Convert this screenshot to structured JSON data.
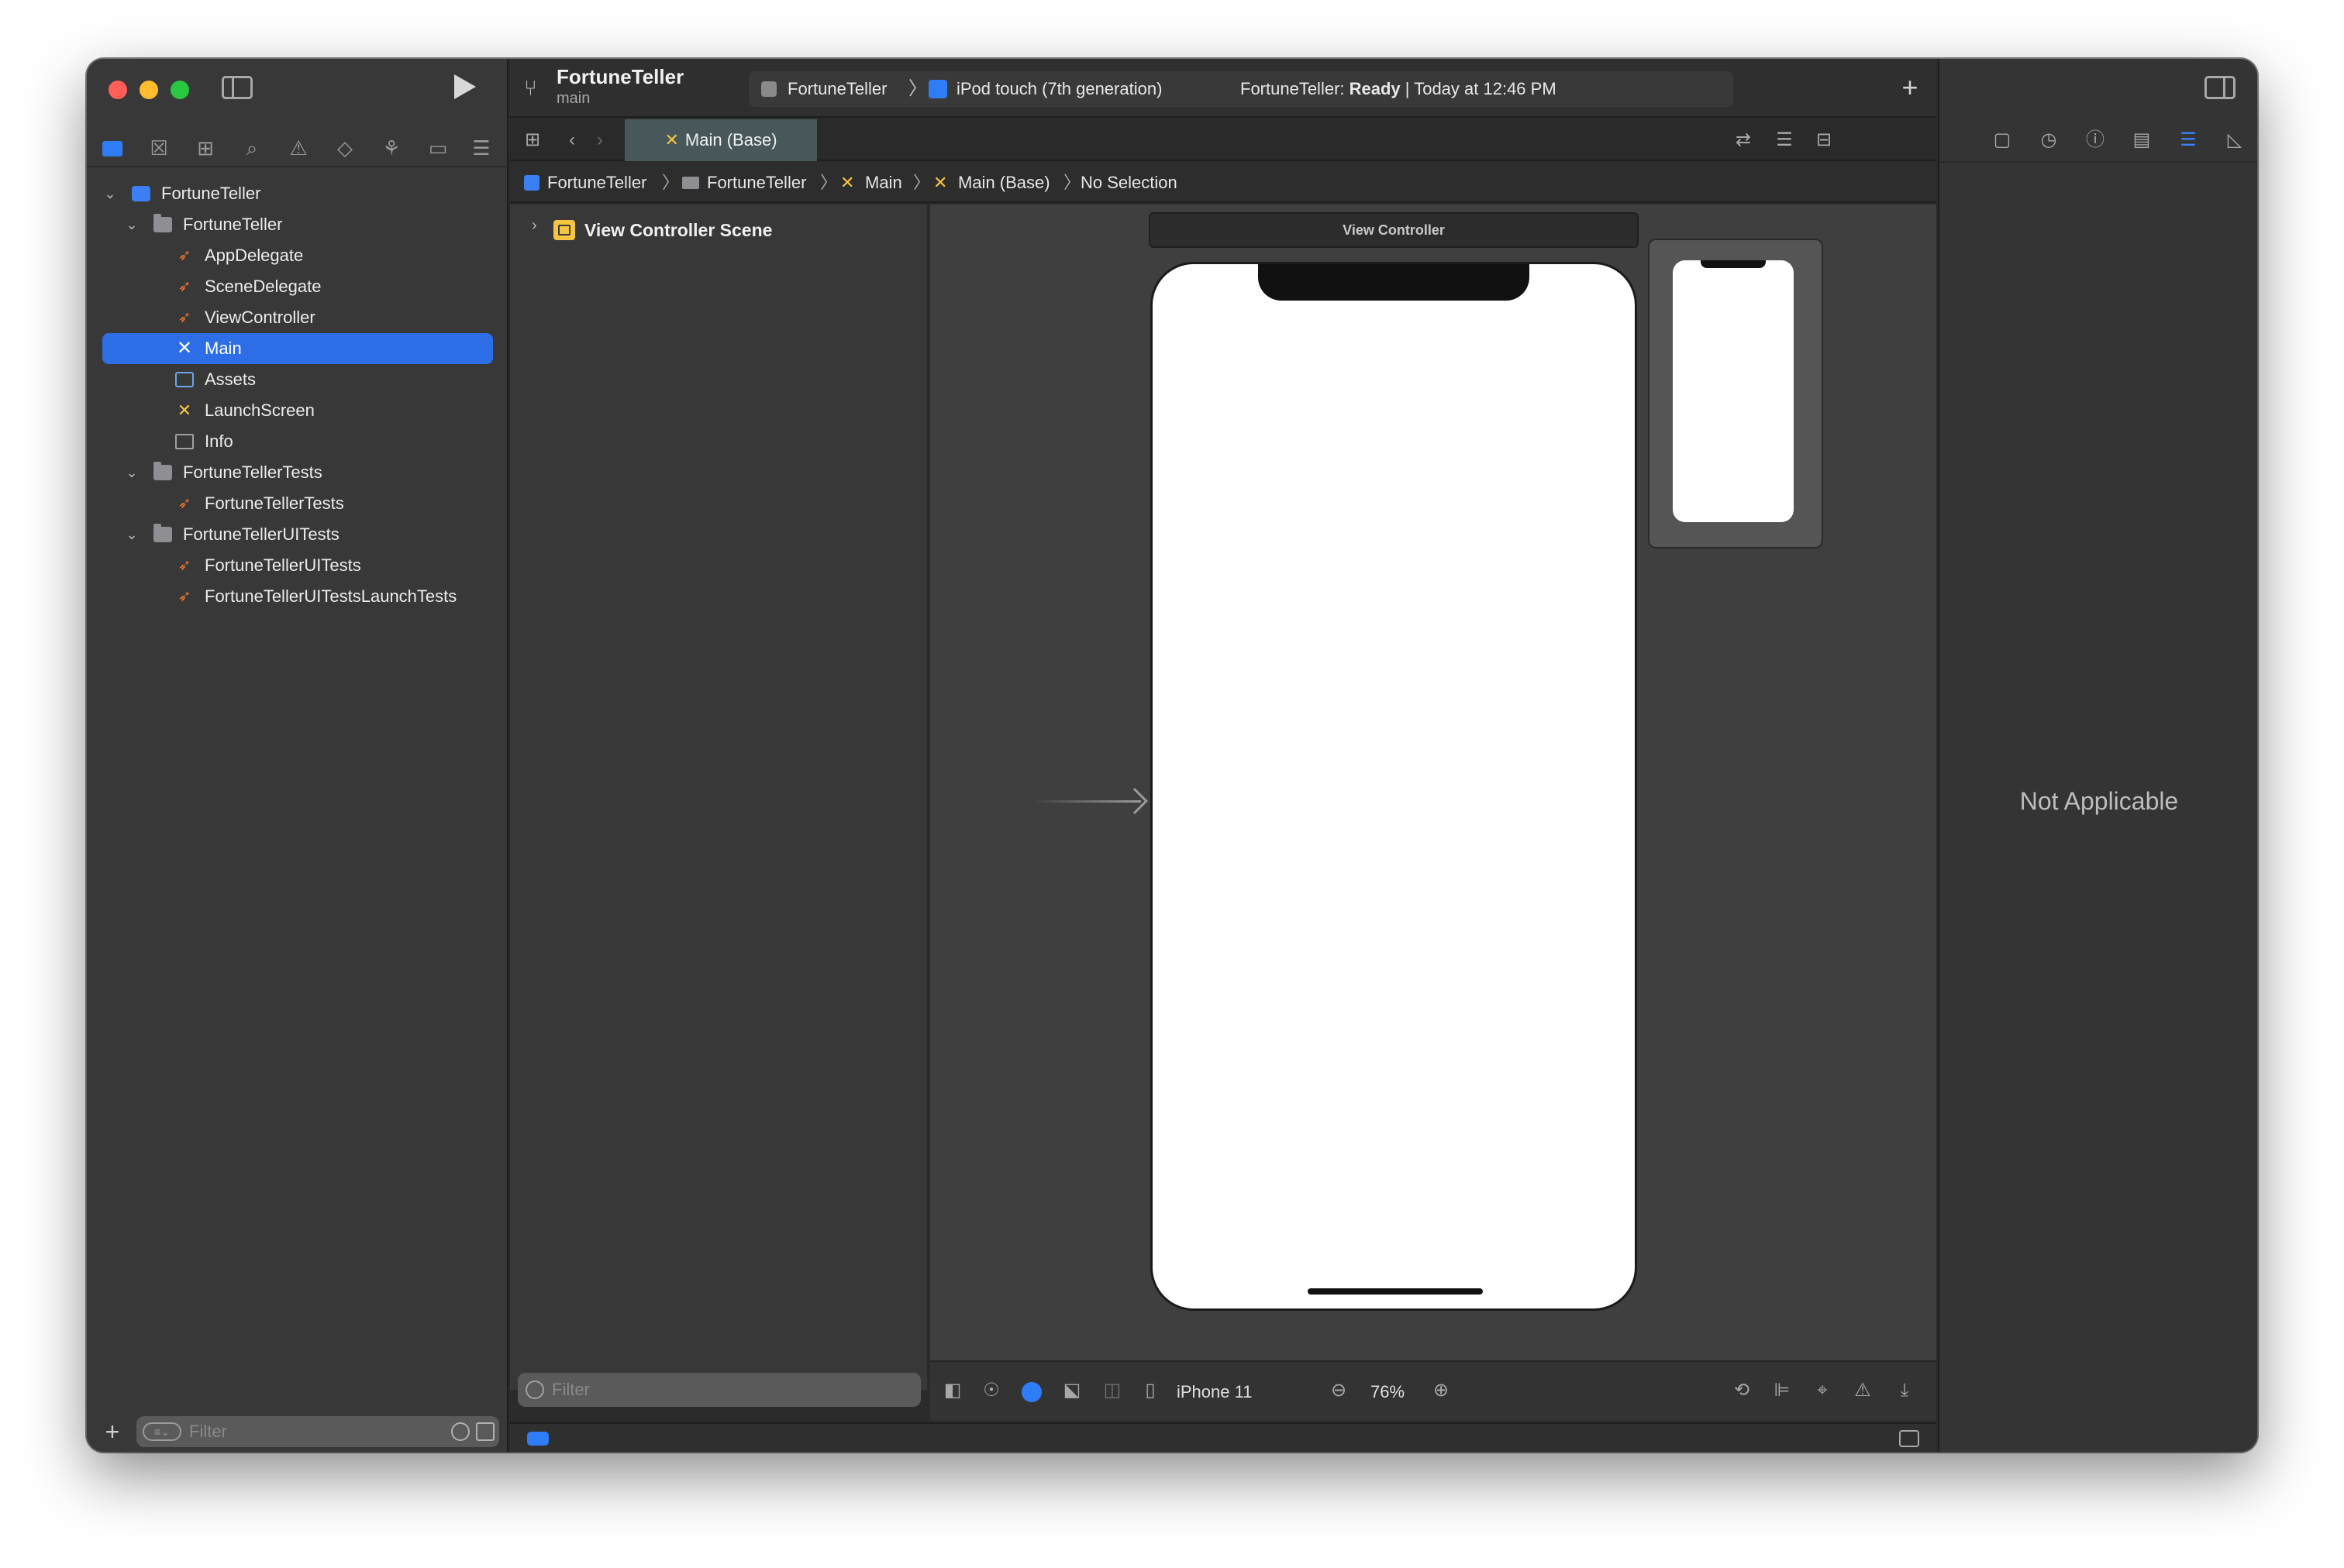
{
  "toolbar": {
    "project_name": "FortuneTeller",
    "branch": "main",
    "scheme": "FortuneTeller",
    "destination": "iPod touch (7th generation)",
    "status_prefix": "FortuneTeller: ",
    "status_bold": "Ready",
    "status_suffix": " | Today at 12:46 PM",
    "add_label": "+"
  },
  "tab": {
    "label": "Main (Base)"
  },
  "jumpbar": {
    "items": [
      "FortuneTeller",
      "FortuneTeller",
      "Main",
      "Main (Base)",
      "No Selection"
    ]
  },
  "navigator": {
    "items": [
      {
        "label": "FortuneTeller"
      },
      {
        "label": "FortuneTeller"
      },
      {
        "label": "AppDelegate"
      },
      {
        "label": "SceneDelegate"
      },
      {
        "label": "ViewController"
      },
      {
        "label": "Main"
      },
      {
        "label": "Assets"
      },
      {
        "label": "LaunchScreen"
      },
      {
        "label": "Info"
      },
      {
        "label": "FortuneTellerTests"
      },
      {
        "label": "FortuneTellerTests"
      },
      {
        "label": "FortuneTellerUITests"
      },
      {
        "label": "FortuneTellerUITests"
      },
      {
        "label": "FortuneTellerUITestsLaunchTests"
      }
    ],
    "filter_placeholder": "Filter"
  },
  "outline": {
    "scene_label": "View Controller Scene",
    "filter_placeholder": "Filter"
  },
  "canvas": {
    "vc_title": "View Controller",
    "device": "iPhone 11",
    "zoom": "76%"
  },
  "inspector": {
    "message": "Not Applicable"
  },
  "colors": {
    "selection": "#2d6ee6",
    "accent": "#3b82f6",
    "swift": "#f2772e",
    "storyboard": "#f5c542"
  }
}
